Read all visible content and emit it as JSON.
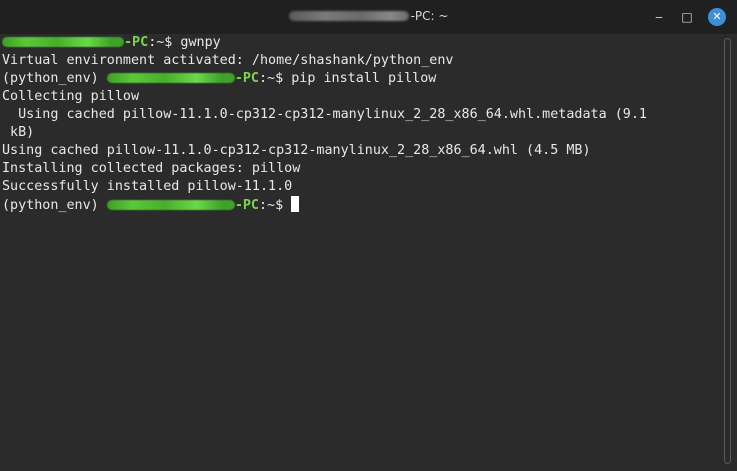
{
  "window": {
    "title_suffix": "-PC: ~",
    "buttons": {
      "minimize": "‒",
      "maximize": "□",
      "close": "✕"
    }
  },
  "terminal": {
    "lines": [
      {
        "type": "prompt",
        "env": "",
        "host_suffix": "-PC",
        "path": ":~$",
        "cmd": " gwnpy"
      },
      {
        "type": "output",
        "text": "Virtual environment activated: /home/shashank/python_env"
      },
      {
        "type": "prompt",
        "env": "(python_env) ",
        "host_suffix": "-PC",
        "path": ":~$",
        "cmd": " pip install pillow"
      },
      {
        "type": "output",
        "text": "Collecting pillow"
      },
      {
        "type": "output",
        "text": "  Using cached pillow-11.1.0-cp312-cp312-manylinux_2_28_x86_64.whl.metadata (9.1"
      },
      {
        "type": "output",
        "text": " kB)"
      },
      {
        "type": "output",
        "text": "Using cached pillow-11.1.0-cp312-cp312-manylinux_2_28_x86_64.whl (4.5 MB)"
      },
      {
        "type": "output",
        "text": "Installing collected packages: pillow"
      },
      {
        "type": "output",
        "text": "Successfully installed pillow-11.1.0"
      },
      {
        "type": "prompt",
        "env": "(python_env) ",
        "host_suffix": "-PC",
        "path": ":~$",
        "cmd": ""
      }
    ]
  },
  "colors": {
    "terminal_bg": "#2b2b2b",
    "titlebar_bg": "#202020",
    "prompt_green": "#7cd64d",
    "close_button": "#3d8fd8"
  }
}
